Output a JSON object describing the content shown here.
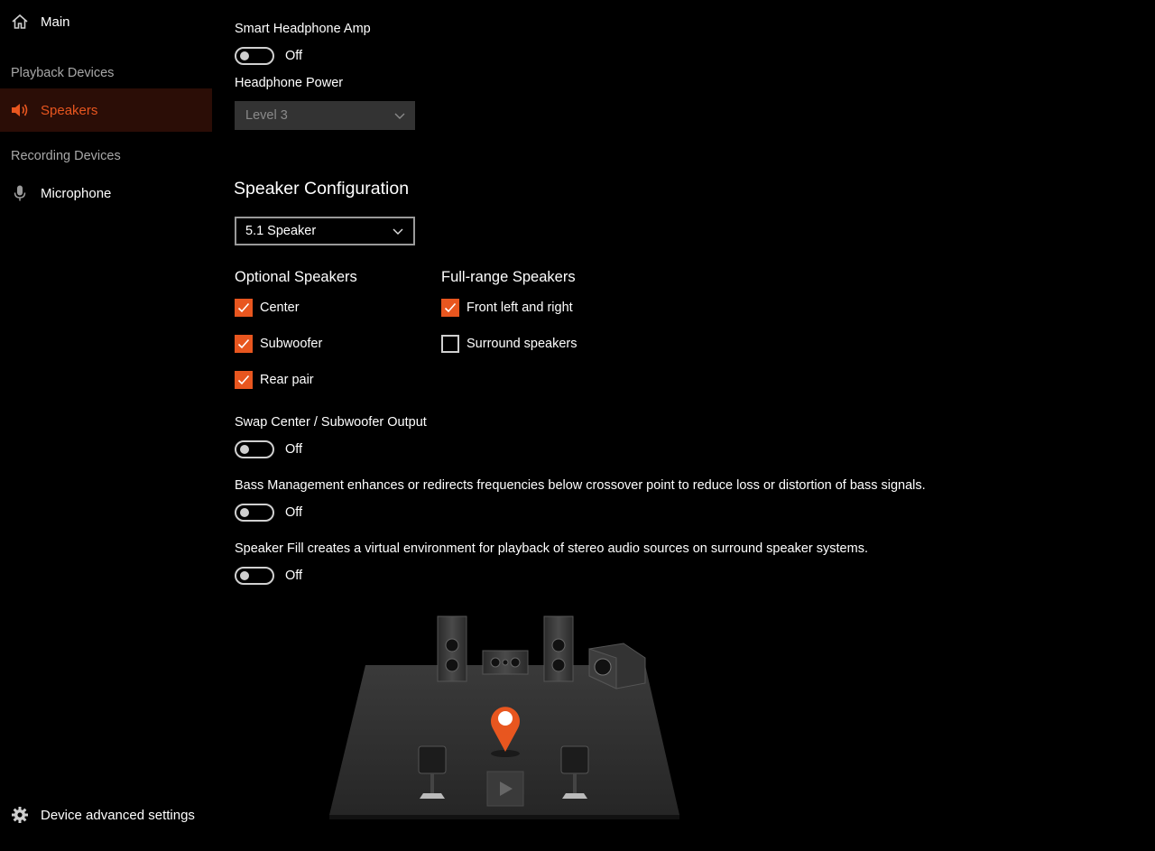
{
  "sidebar": {
    "main": {
      "label": "Main",
      "icon": "home-icon"
    },
    "playback_section": "Playback Devices",
    "speakers": {
      "label": "Speakers",
      "icon": "speaker-icon"
    },
    "recording_section": "Recording Devices",
    "microphone": {
      "label": "Microphone",
      "icon": "microphone-icon"
    },
    "advanced": {
      "label": "Device advanced settings",
      "icon": "gear-icon"
    }
  },
  "headphone": {
    "amp_label": "Smart Headphone Amp",
    "amp_state": "Off",
    "power_label": "Headphone Power",
    "power_value": "Level 3"
  },
  "speaker_config": {
    "heading": "Speaker Configuration",
    "value": "5.1 Speaker"
  },
  "optional_speakers": {
    "heading": "Optional Speakers",
    "items": [
      {
        "label": "Center",
        "checked": true
      },
      {
        "label": "Subwoofer",
        "checked": true
      },
      {
        "label": "Rear pair",
        "checked": true
      }
    ]
  },
  "full_range": {
    "heading": "Full-range Speakers",
    "items": [
      {
        "label": "Front left and right",
        "checked": true
      },
      {
        "label": "Surround speakers",
        "checked": false
      }
    ]
  },
  "swap": {
    "label": "Swap Center / Subwoofer Output",
    "state": "Off"
  },
  "bass": {
    "label": "Bass Management enhances or redirects frequencies below crossover point to reduce loss or distortion of bass signals.",
    "state": "Off"
  },
  "fill": {
    "label": "Speaker Fill creates a virtual environment for playback of stereo audio sources on surround speaker systems.",
    "state": "Off"
  },
  "colors": {
    "accent": "#e8561f",
    "background": "#000000",
    "active_bg": "#2b0d06"
  }
}
